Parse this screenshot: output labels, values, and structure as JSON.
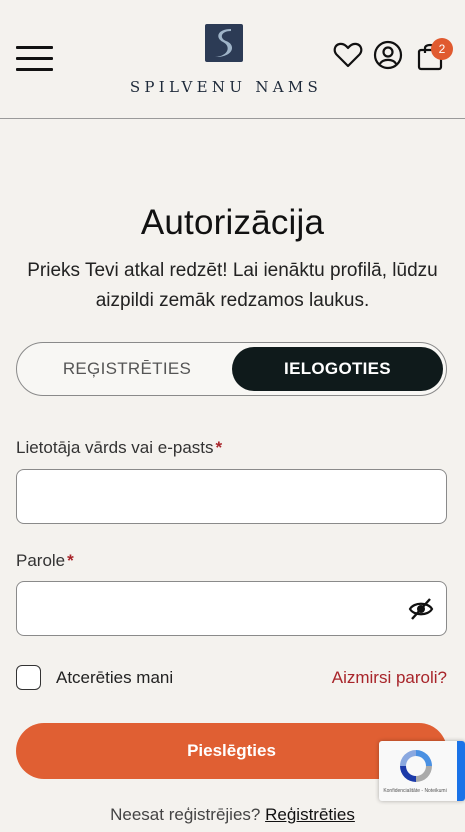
{
  "header": {
    "brand_name": "SPILVENU NAMS",
    "cart_count": "2",
    "icons": [
      "menu-icon",
      "heart-icon",
      "user-icon",
      "bag-icon"
    ]
  },
  "auth": {
    "title": "Autorizācija",
    "subtitle": "Prieks Tevi atkal redzēt! Lai ienāktu profilā, lūdzu aizpildi zemāk redzamos laukus.",
    "tab_register": "REĢISTRĒTIES",
    "tab_login": "IELOGOTIES"
  },
  "form": {
    "username_label": "Lietotāja vārds vai e-pasts",
    "username_value": "",
    "password_label": "Parole",
    "password_value": "",
    "required_mark": "*",
    "remember_label": "Atcerēties mani",
    "remember_checked": false,
    "forgot_label": "Aizmirsi paroli?",
    "submit_label": "Pieslēgties"
  },
  "footer": {
    "prompt": "Neesat reģistrējies?",
    "register_link": "Reģistrēties"
  },
  "recaptcha": {
    "text": "Konfidencialitāte - Noteikumi"
  },
  "colors": {
    "accent": "#e05f33",
    "dark": "#0f1a1b",
    "link_red": "#a8252a",
    "background": "#f4f2ee",
    "logo_navy": "#1e2a3a"
  }
}
